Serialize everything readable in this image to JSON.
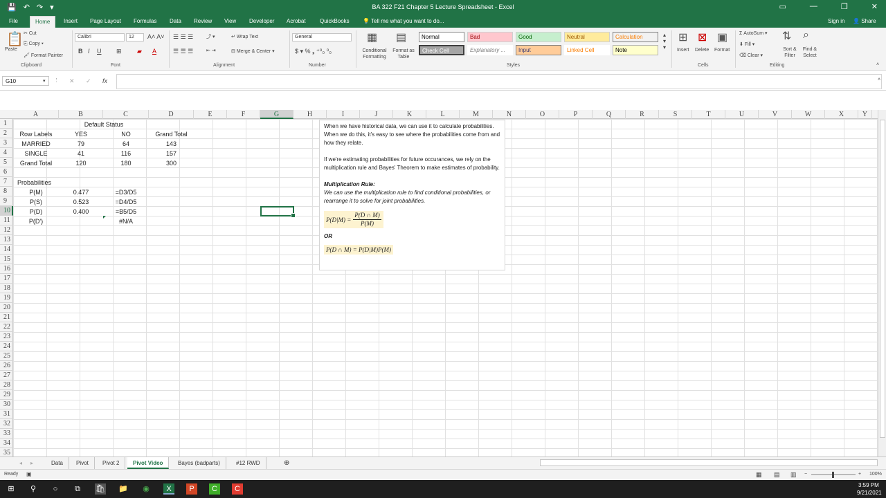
{
  "window": {
    "title": "BA 322 F21 Chapter 5 Lecture Spreadsheet - Excel"
  },
  "tabs": [
    "File",
    "Home",
    "Insert",
    "Page Layout",
    "Formulas",
    "Data",
    "Review",
    "View",
    "Developer",
    "Acrobat",
    "QuickBooks"
  ],
  "tell_me": "Tell me what you want to do...",
  "account": {
    "signin": "Sign in",
    "share": "Share"
  },
  "ribbon": {
    "clipboard": {
      "paste": "Paste",
      "cut": "Cut",
      "copy": "Copy",
      "format_painter": "Format Painter",
      "label": "Clipboard"
    },
    "font": {
      "name": "Calibri",
      "size": "12",
      "label": "Font"
    },
    "alignment": {
      "wrap": "Wrap Text",
      "merge": "Merge & Center",
      "label": "Alignment"
    },
    "number": {
      "format": "General",
      "label": "Number"
    },
    "styles": {
      "cond": "Conditional Formatting",
      "fmt_table": "Format as Table",
      "items": [
        "Normal",
        "Bad",
        "Good",
        "Neutral",
        "Calculation",
        "Check Cell",
        "Explanatory ...",
        "Input",
        "Linked Cell",
        "Note"
      ],
      "label": "Styles"
    },
    "cells": {
      "insert": "Insert",
      "delete": "Delete",
      "format": "Format",
      "label": "Cells"
    },
    "editing": {
      "autosum": "AutoSum",
      "fill": "Fill",
      "clear": "Clear",
      "sort": "Sort & Filter",
      "find": "Find & Select",
      "label": "Editing"
    }
  },
  "namebox": "G10",
  "columns": [
    "A",
    "B",
    "C",
    "D",
    "E",
    "F",
    "G",
    "H",
    "I",
    "J",
    "K",
    "L",
    "M",
    "N",
    "O",
    "P",
    "Q",
    "R",
    "S",
    "T",
    "U",
    "V",
    "W",
    "X",
    "Y"
  ],
  "rows": [
    "1",
    "2",
    "3",
    "4",
    "5",
    "6",
    "7",
    "8",
    "9",
    "10",
    "11",
    "12",
    "13",
    "14",
    "15",
    "16",
    "17",
    "18",
    "19",
    "20",
    "21",
    "22",
    "23",
    "24",
    "25",
    "26",
    "27",
    "28",
    "29",
    "30",
    "31",
    "32",
    "33",
    "34",
    "35"
  ],
  "pivot": {
    "title": "Default Status",
    "header": [
      "Row Labels",
      "YES",
      "NO",
      "Grand Total"
    ],
    "rows": [
      [
        "MARRIED",
        "79",
        "64",
        "143"
      ],
      [
        "SINGLE",
        "41",
        "116",
        "157"
      ],
      [
        "Grand Total",
        "120",
        "180",
        "300"
      ]
    ]
  },
  "probabilities": {
    "title": "Probabilities",
    "rows": [
      [
        "P(M)",
        "0.477",
        "=D3/D5"
      ],
      [
        "P(S)",
        "0.523",
        "=D4/D5"
      ],
      [
        "P(D)",
        "0.400",
        "=B5/D5"
      ],
      [
        "P(D')",
        "",
        "#N/A"
      ]
    ]
  },
  "note": {
    "p1": "When we have historical data, we can use it to calculate probabilities. When we do this, it's easy to see where the probabilities come from and how they relate.",
    "p2": "If we're estimating probabilities for future occurances, we rely on the multiplication rule and Bayes' Theorem to make estimates of probability.",
    "rule_title": "Multiplication Rule:",
    "rule_text": "We can use the multiplication rule to find conditional probabilities, or rearrange it to solve for joint probabilities.",
    "eq1_lhs": "P(D|M) =",
    "eq1_num": "P(D ∩ M)",
    "eq1_den": "P(M)",
    "or": "OR",
    "eq2": "P(D ∩ M) = P(D|M)P(M)"
  },
  "sheets": [
    "Data",
    "Pivot",
    "Pivot 2",
    "Pivot Video",
    "Bayes (badparts)",
    "#12 RWD"
  ],
  "status": {
    "ready": "Ready",
    "zoom": "100%"
  },
  "clock": {
    "time": "3:59 PM",
    "date": "9/21/2021"
  }
}
